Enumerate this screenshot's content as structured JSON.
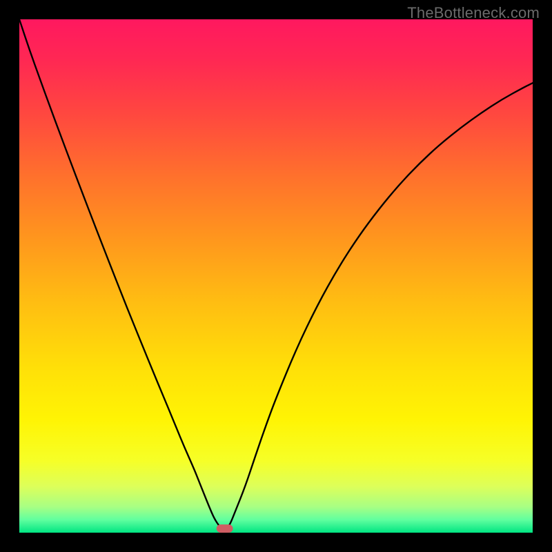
{
  "watermark": "TheBottleneck.com",
  "colors": {
    "curve": "#000000",
    "marker_fill": "#cf5d63",
    "marker_stroke": "#cf5d63",
    "frame": "#000000"
  },
  "gradient_stops": [
    {
      "offset": 0.0,
      "color": "#ff185f"
    },
    {
      "offset": 0.08,
      "color": "#ff2853"
    },
    {
      "offset": 0.18,
      "color": "#ff4640"
    },
    {
      "offset": 0.3,
      "color": "#ff6f2d"
    },
    {
      "offset": 0.42,
      "color": "#ff941e"
    },
    {
      "offset": 0.55,
      "color": "#ffbd12"
    },
    {
      "offset": 0.68,
      "color": "#ffe008"
    },
    {
      "offset": 0.78,
      "color": "#fff404"
    },
    {
      "offset": 0.86,
      "color": "#f6ff27"
    },
    {
      "offset": 0.91,
      "color": "#ddff5a"
    },
    {
      "offset": 0.95,
      "color": "#a7ff84"
    },
    {
      "offset": 0.975,
      "color": "#60ff9f"
    },
    {
      "offset": 1.0,
      "color": "#00e582"
    }
  ],
  "chart_data": {
    "type": "line",
    "title": "",
    "xlabel": "",
    "ylabel": "",
    "xlim": [
      0,
      100
    ],
    "ylim": [
      0,
      100
    ],
    "x": [
      0,
      2,
      4,
      6,
      8,
      10,
      12,
      14,
      16,
      18,
      20,
      22,
      24,
      26,
      28,
      30,
      32,
      34,
      35,
      36,
      37,
      38,
      39,
      40,
      41,
      42,
      44,
      46,
      48,
      50,
      54,
      58,
      62,
      66,
      70,
      74,
      78,
      82,
      86,
      90,
      94,
      98,
      100
    ],
    "series": [
      {
        "name": "left-curve",
        "values": [
          100,
          94,
          88.4,
          82.9,
          77.5,
          72.2,
          66.9,
          61.7,
          56.5,
          51.4,
          46.3,
          41.3,
          36.4,
          31.5,
          26.7,
          21.9,
          17,
          12.5,
          10,
          7.5,
          5,
          2.7,
          1.2,
          0.3,
          null,
          null,
          null,
          null,
          null,
          null,
          null,
          null,
          null,
          null,
          null,
          null,
          null,
          null,
          null,
          null,
          null,
          null,
          null
        ]
      },
      {
        "name": "right-curve",
        "values": [
          null,
          null,
          null,
          null,
          null,
          null,
          null,
          null,
          null,
          null,
          null,
          null,
          null,
          null,
          null,
          null,
          null,
          null,
          null,
          null,
          null,
          null,
          null,
          0.3,
          1.5,
          4,
          9,
          15,
          20.8,
          26.2,
          35.9,
          44.2,
          51.4,
          57.6,
          63,
          67.8,
          72,
          75.7,
          78.9,
          81.8,
          84.4,
          86.6,
          87.6
        ]
      }
    ],
    "marker": {
      "x_center": 40,
      "width": 3.2,
      "height": 1.6
    }
  }
}
